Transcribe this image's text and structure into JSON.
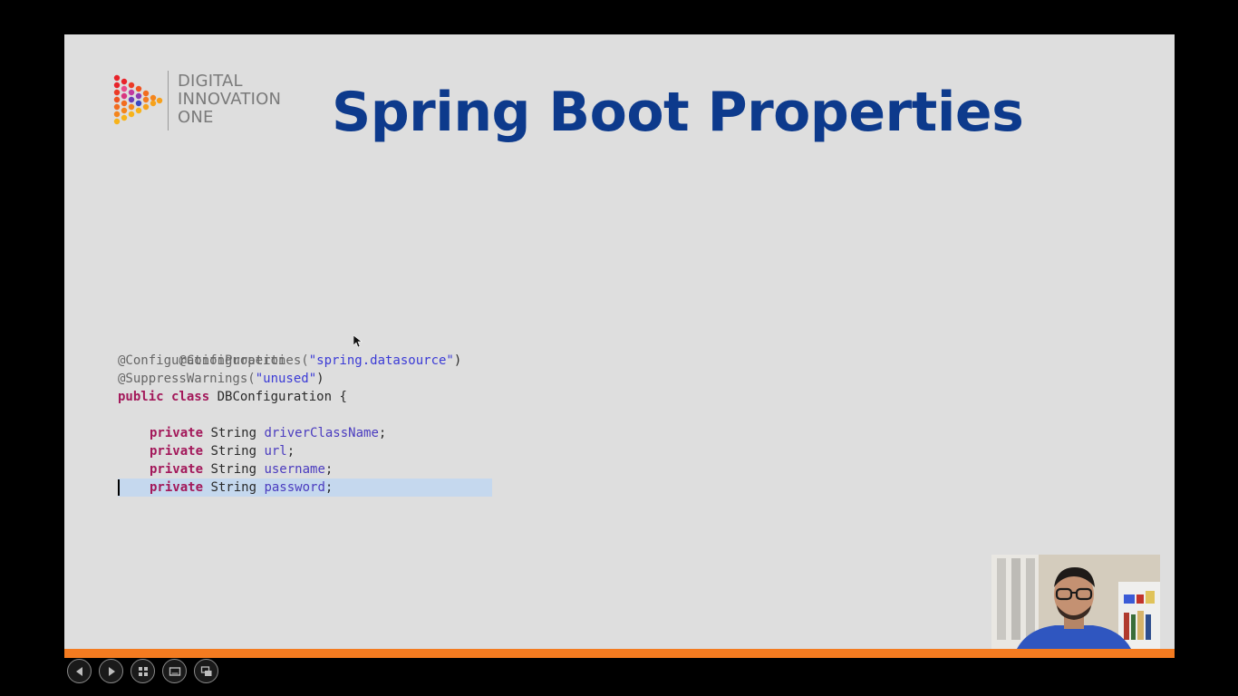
{
  "logo": {
    "lines": [
      "DIGITAL",
      "INNOVATION",
      "ONE"
    ]
  },
  "slide": {
    "title": "Spring Boot Properties"
  },
  "code": {
    "line1": "@Configuration",
    "line2_anno": "@ConfigurationProperties(",
    "line2_str": "\"spring.datasource\"",
    "line2_end": ")",
    "line3_anno": "@SuppressWarnings(",
    "line3_str": "\"unused\"",
    "line3_end": ")",
    "line4_kw": "public class",
    "line4_rest": " DBConfiguration {",
    "field_kw": "private",
    "field_type": " String ",
    "fields": [
      "driverClassName",
      "url",
      "username",
      "password"
    ],
    "semicolon": ";"
  },
  "controls": {
    "icons": [
      "previous-slide-icon",
      "next-slide-icon",
      "slide-sorter-icon",
      "reading-view-icon",
      "presenter-view-icon"
    ]
  },
  "colors": {
    "title": "#0d3a8c",
    "accent_bar": "#f47b20",
    "slide_bg": "#dedede",
    "keyword": "#a3185a",
    "string": "#3b3bd6",
    "highlight": "#c5d8ee"
  }
}
